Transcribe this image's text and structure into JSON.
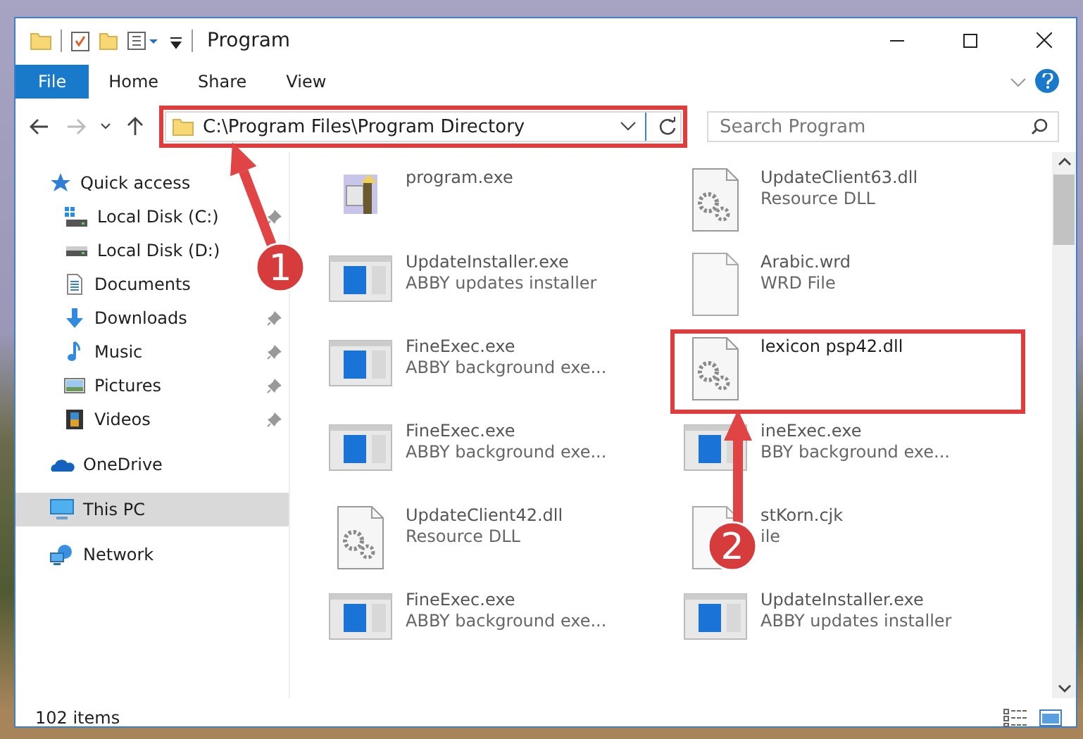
{
  "window": {
    "title": "Program"
  },
  "ribbon": {
    "tabs": [
      {
        "label": "File",
        "selected": true
      },
      {
        "label": "Home",
        "selected": false
      },
      {
        "label": "Share",
        "selected": false
      },
      {
        "label": "View",
        "selected": false
      }
    ]
  },
  "address": {
    "path": "C:\\Program Files\\Program Directory",
    "highlighted": true
  },
  "search": {
    "placeholder": "Search Program"
  },
  "sidebar": {
    "items": [
      {
        "label": "Quick access",
        "kind": "star",
        "selected": false,
        "children": [
          {
            "label": "Local Disk (C:)",
            "kind": "system-drive",
            "pinned": true,
            "selected": false
          },
          {
            "label": "Local Disk (D:)",
            "kind": "drive",
            "pinned": false,
            "selected": false
          },
          {
            "label": "Documents",
            "kind": "documents",
            "pinned": false,
            "selected": false
          },
          {
            "label": "Downloads",
            "kind": "downloads",
            "pinned": true,
            "selected": false
          },
          {
            "label": "Music",
            "kind": "music",
            "pinned": true,
            "selected": false
          },
          {
            "label": "Pictures",
            "kind": "pictures",
            "pinned": true,
            "selected": false
          },
          {
            "label": "Videos",
            "kind": "videos",
            "pinned": true,
            "selected": false
          }
        ]
      },
      {
        "label": "OneDrive",
        "kind": "cloud",
        "selected": false
      },
      {
        "label": "This PC",
        "kind": "pc",
        "selected": true
      },
      {
        "label": "Network",
        "kind": "network",
        "selected": false
      }
    ]
  },
  "files": [
    {
      "name": "program.exe",
      "kind": "setup",
      "highlighted": false
    },
    {
      "name": "UpdateClient63.dll",
      "description": "Resource DLL",
      "kind": "dll",
      "highlighted": false
    },
    {
      "name": "UpdateInstaller.exe",
      "description": "ABBY updates installer",
      "kind": "app",
      "highlighted": false
    },
    {
      "name": "Arabic.wrd",
      "description": "WRD File",
      "kind": "blank",
      "highlighted": false
    },
    {
      "name": "FineExec.exe",
      "description": "ABBY background exe...",
      "kind": "app",
      "highlighted": false
    },
    {
      "name": "lexicon psp42.dll",
      "kind": "dll",
      "highlighted": true
    },
    {
      "name": "FineExec.exe",
      "description": "ABBY background exe...",
      "kind": "app",
      "highlighted": false
    },
    {
      "name": "ineExec.exe",
      "description": "BBY background exe...",
      "kind": "app",
      "highlighted": false
    },
    {
      "name": "UpdateClient42.dll",
      "description": "Resource DLL",
      "kind": "dll",
      "highlighted": false
    },
    {
      "name": "stKorn.cjk",
      "description": "ile",
      "kind": "blank",
      "highlighted": false
    },
    {
      "name": "FineExec.exe",
      "description": "ABBY background exe...",
      "kind": "app",
      "highlighted": false
    },
    {
      "name": "UpdateInstaller.exe",
      "description": "ABBY updates installer",
      "kind": "app",
      "highlighted": false
    }
  ],
  "status_bar": {
    "item_count": "102 items"
  },
  "annotations": [
    {
      "number": "1"
    },
    {
      "number": "2"
    }
  ]
}
